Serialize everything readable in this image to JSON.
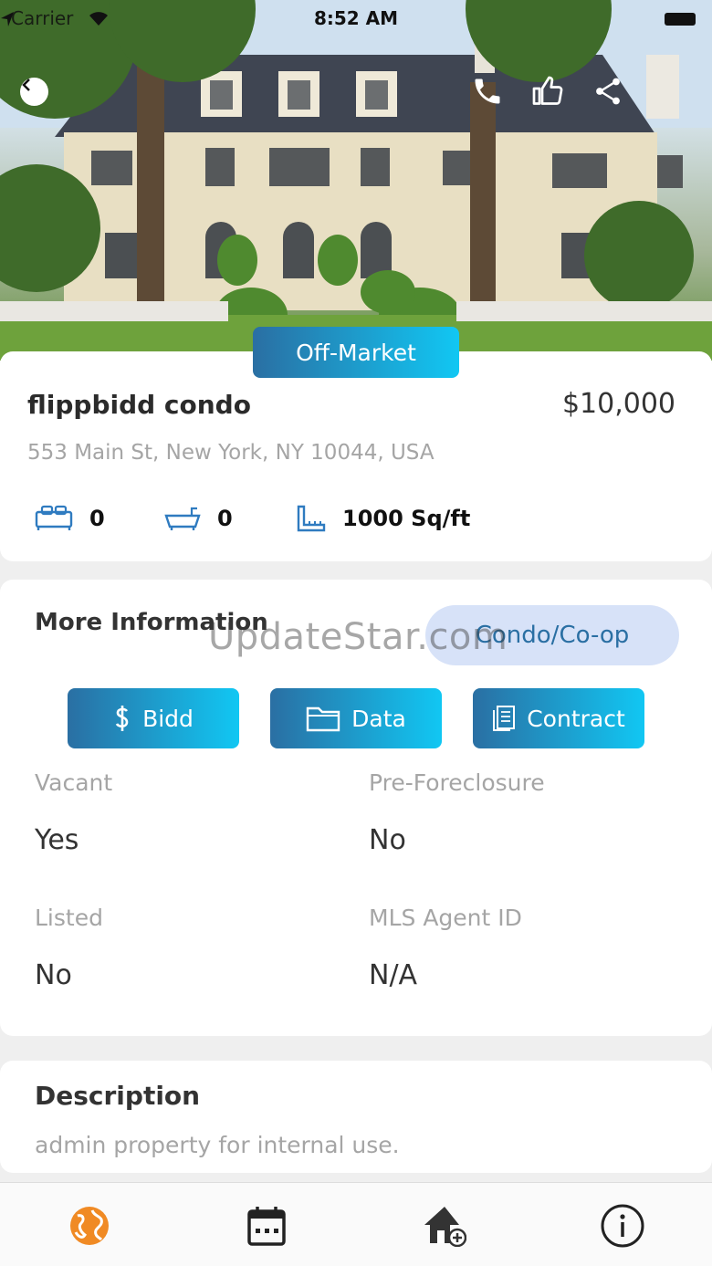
{
  "status_bar": {
    "carrier": "Carrier",
    "time": "8:52 AM"
  },
  "listing": {
    "status_badge": "Off-Market",
    "title": "flippbidd condo",
    "price": "$10,000",
    "address": "553 Main St, New York, NY 10044, USA",
    "bedrooms": "0",
    "bathrooms": "0",
    "area": "1000 Sq/ft"
  },
  "more_info": {
    "heading": "More Information",
    "watermark": "UpdateStar.com",
    "property_type": "Condo/Co-op",
    "buttons": {
      "bidd": "Bidd",
      "data": "Data",
      "contract": "Contract"
    },
    "fields": {
      "vacant_label": "Vacant",
      "vacant_value": "Yes",
      "preforeclosure_label": "Pre-Foreclosure",
      "preforeclosure_value": "No",
      "listed_label": "Listed",
      "listed_value": "No",
      "mls_label": "MLS Agent ID",
      "mls_value": "N/A"
    }
  },
  "description": {
    "heading": "Description",
    "text": "admin property for internal use."
  },
  "icons": {
    "back": "chevron-left-icon",
    "phone": "phone-icon",
    "like": "thumbs-up-icon",
    "share": "share-icon",
    "bed": "bed-icon",
    "bath": "bathtub-icon",
    "area": "ruler-icon",
    "tab_explore": "globe-icon",
    "tab_calendar": "calendar-icon",
    "tab_add_home": "add-home-icon",
    "tab_info": "info-icon"
  },
  "colors": {
    "accent_start": "#2a6fa3",
    "accent_end": "#11c7f3",
    "active_tab": "#f08a24",
    "pill_bg": "#d7e2f8"
  }
}
